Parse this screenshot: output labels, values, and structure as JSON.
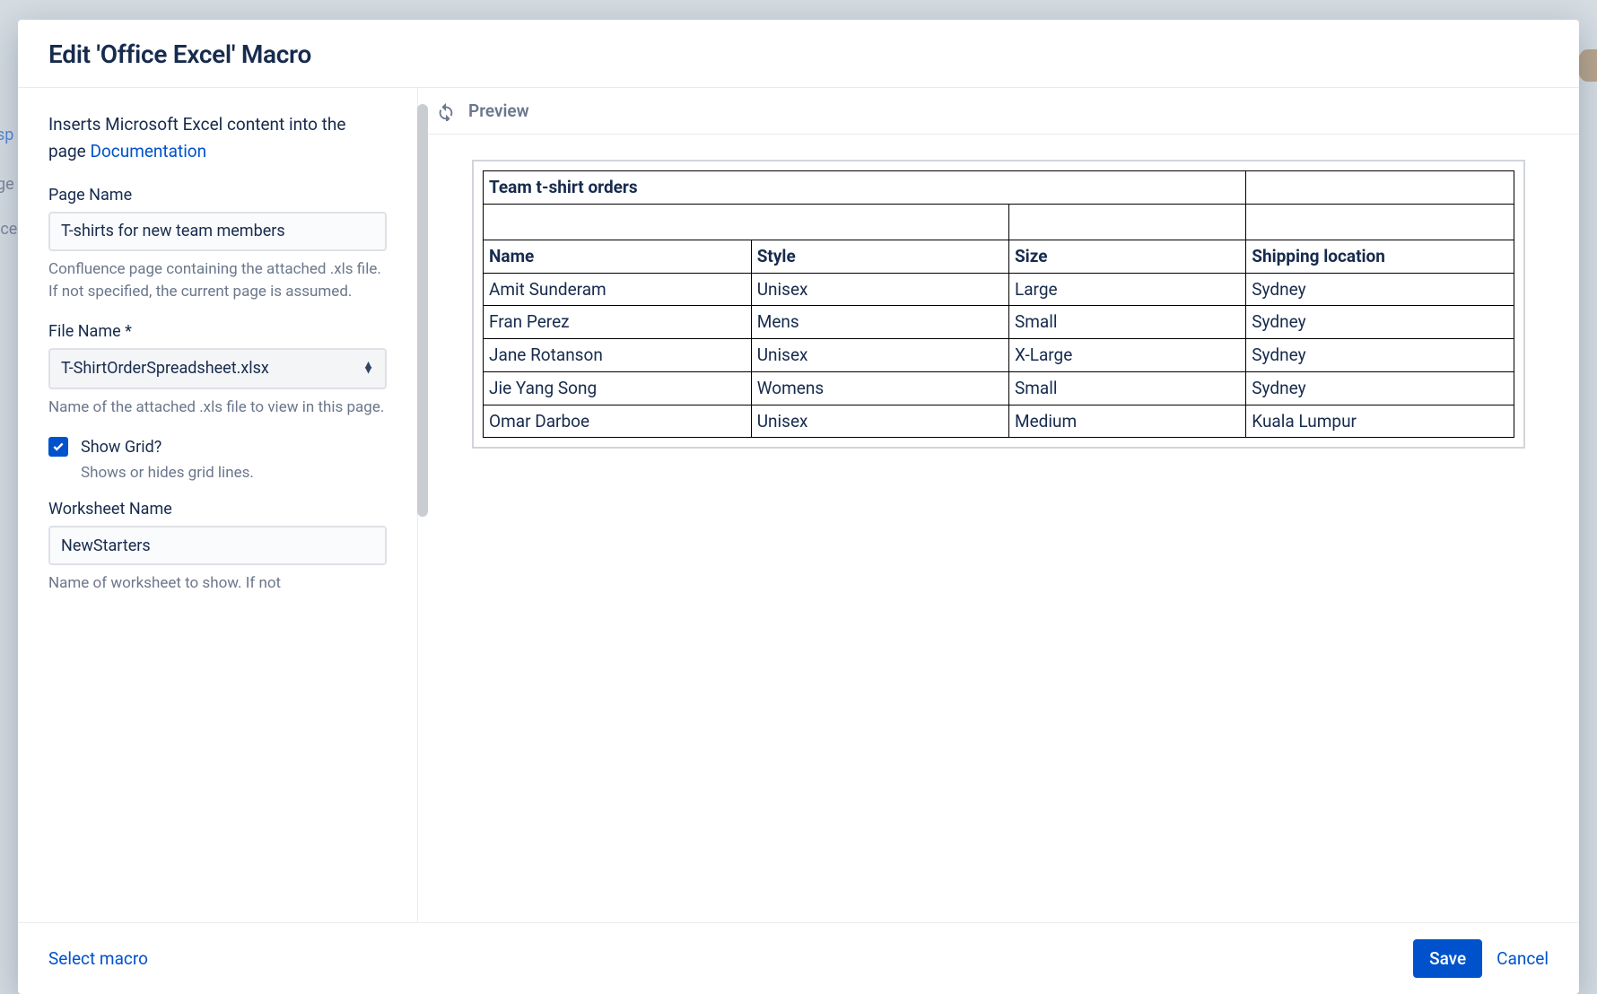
{
  "modal": {
    "title": "Edit 'Office Excel' Macro",
    "description_pre": "Inserts Microsoft Excel content into the page ",
    "doc_link": "Documentation"
  },
  "fields": {
    "page_name": {
      "label": "Page Name",
      "value": "T-shirts for new team members",
      "help": "Confluence page containing the attached .xls file. If not specified, the current page is assumed."
    },
    "file_name": {
      "label": "File Name *",
      "value": "T-ShirtOrderSpreadsheet.xlsx",
      "help": "Name of the attached .xls file to view in this page."
    },
    "show_grid": {
      "label": "Show Grid?",
      "checked": true,
      "help": "Shows or hides grid lines."
    },
    "worksheet": {
      "label": "Worksheet Name",
      "value": "NewStarters",
      "help": "Name of worksheet to show. If not"
    }
  },
  "preview": {
    "label": "Preview",
    "title": "Team t-shirt orders",
    "columns": [
      "Name",
      "Style",
      "Size",
      "Shipping location"
    ],
    "rows": [
      [
        "Amit Sunderam",
        "Unisex",
        "Large",
        "Sydney"
      ],
      [
        "Fran Perez",
        "Mens",
        "Small",
        "Sydney"
      ],
      [
        "Jane Rotanson",
        "Unisex",
        "X-Large",
        "Sydney"
      ],
      [
        "Jie Yang Song",
        "Womens",
        "Small",
        "Sydney"
      ],
      [
        "Omar Darboe",
        "Unisex",
        "Medium",
        "Kuala Lumpur"
      ]
    ]
  },
  "footer": {
    "select_macro": "Select macro",
    "save": "Save",
    "cancel": "Cancel"
  }
}
